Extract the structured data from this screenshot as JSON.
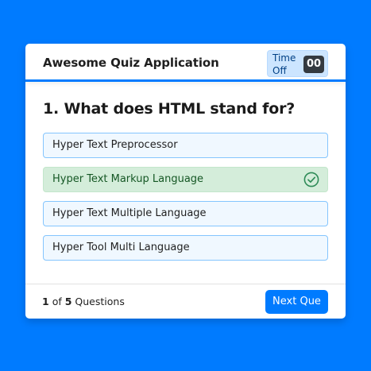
{
  "header": {
    "title": "Awesome Quiz Application",
    "timer": {
      "label": "Time Off",
      "seconds": "00"
    }
  },
  "question": {
    "number": "1",
    "text": "1. What does HTML stand for?",
    "options": [
      {
        "label": "Hyper Text Preprocessor",
        "state": "default"
      },
      {
        "label": "Hyper Text Markup Language",
        "state": "correct",
        "icon": "check-circle-icon"
      },
      {
        "label": "Hyper Text Multiple Language",
        "state": "default"
      },
      {
        "label": "Hyper Tool Multi Language",
        "state": "default"
      }
    ]
  },
  "footer": {
    "current": "1",
    "of_text": "of",
    "total": "5",
    "questions_text": "Questions",
    "next_label": "Next Que"
  },
  "colors": {
    "page_background": "#007bff",
    "accent": "#007bff",
    "option_background": "#f0f8ff",
    "option_border": "#84c5fe",
    "correct_background": "#d4edda",
    "correct_text": "#155724",
    "correct_icon": "#2e8b57",
    "timer_background": "#cce5ff",
    "timer_seconds_background": "#343a40"
  }
}
